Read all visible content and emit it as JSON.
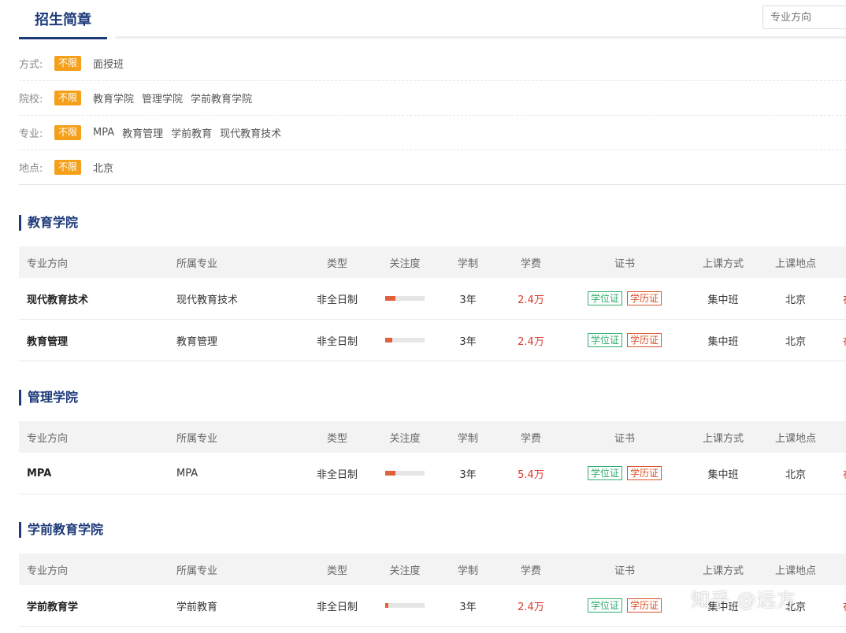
{
  "header": {
    "title": "招生简章",
    "search_placeholder": "专业方向"
  },
  "filters": [
    {
      "label": "方式:",
      "tag": "不限",
      "options": [
        "面授班"
      ]
    },
    {
      "label": "院校:",
      "tag": "不限",
      "options": [
        "教育学院",
        "管理学院",
        "学前教育学院"
      ]
    },
    {
      "label": "专业:",
      "tag": "不限",
      "options": [
        "MPA",
        "教育管理",
        "学前教育",
        "现代教育技术"
      ]
    },
    {
      "label": "地点:",
      "tag": "不限",
      "options": [
        "北京"
      ]
    }
  ],
  "columns": [
    "专业方向",
    "所属专业",
    "类型",
    "关注度",
    "学制",
    "学费",
    "证书",
    "上课方式",
    "上课地点"
  ],
  "sections": [
    {
      "title": "教育学院",
      "rows": [
        {
          "direction": "现代教育技术",
          "major": "现代教育技术",
          "type": "非全日制",
          "attention": 0.26,
          "system": "3年",
          "fee": "2.4万",
          "cert_degree": "学位证",
          "cert_diploma": "学历证",
          "way": "集中班",
          "location": "北京",
          "more": "在"
        },
        {
          "direction": "教育管理",
          "major": "教育管理",
          "type": "非全日制",
          "attention": 0.18,
          "system": "3年",
          "fee": "2.4万",
          "cert_degree": "学位证",
          "cert_diploma": "学历证",
          "way": "集中班",
          "location": "北京",
          "more": "在"
        }
      ]
    },
    {
      "title": "管理学院",
      "rows": [
        {
          "direction": "MPA",
          "major": "MPA",
          "type": "非全日制",
          "attention": 0.26,
          "system": "3年",
          "fee": "5.4万",
          "cert_degree": "学位证",
          "cert_diploma": "学历证",
          "way": "集中班",
          "location": "北京",
          "more": "在"
        }
      ]
    },
    {
      "title": "学前教育学院",
      "rows": [
        {
          "direction": "学前教育学",
          "major": "学前教育",
          "type": "非全日制",
          "attention": 0.08,
          "system": "3年",
          "fee": "2.4万",
          "cert_degree": "学位证",
          "cert_diploma": "学历证",
          "way": "集中班",
          "location": "北京",
          "more": "在"
        }
      ]
    }
  ],
  "watermark": "知乎 @远方",
  "colors": {
    "accent": "#1d3a7a",
    "tag": "#f5a01a",
    "fee": "#d9392d",
    "degree": "#2fae6e",
    "diploma": "#d9532d",
    "bar": "#e0603a"
  }
}
